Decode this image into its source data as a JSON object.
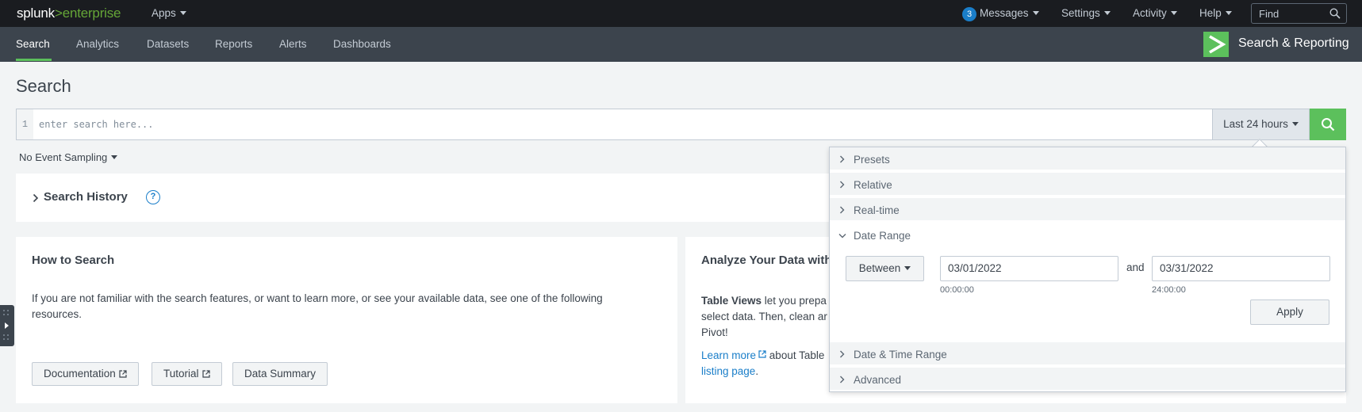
{
  "topbar": {
    "logo_main": "splunk",
    "logo_sep": ">",
    "logo_product": "enterprise",
    "apps_label": "Apps",
    "messages_count": "3",
    "messages_label": "Messages",
    "settings_label": "Settings",
    "activity_label": "Activity",
    "help_label": "Help",
    "find_placeholder": "Find"
  },
  "nav": {
    "tabs": [
      {
        "label": "Search"
      },
      {
        "label": "Analytics"
      },
      {
        "label": "Datasets"
      },
      {
        "label": "Reports"
      },
      {
        "label": "Alerts"
      },
      {
        "label": "Dashboards"
      }
    ],
    "active_tab": "Search",
    "app_title": "Search & Reporting"
  },
  "page": {
    "title": "Search"
  },
  "search": {
    "line_number": "1",
    "placeholder": "enter search here...",
    "time_range": "Last 24 hours",
    "event_sampling": "No Event Sampling"
  },
  "history": {
    "title": "Search History"
  },
  "how_to": {
    "title": "How to Search",
    "text": "If you are not familiar with the search features, or want to learn more, or see your available data, see one of the following resources.",
    "buttons": [
      {
        "label": "Documentation"
      },
      {
        "label": "Tutorial"
      },
      {
        "label": "Data Summary"
      }
    ]
  },
  "analyze": {
    "title": "Analyze Your Data with",
    "line1_bold": "Table Views",
    "line1_rest": " let you prepa",
    "line2": "select data. Then, clean ar",
    "line3": "Pivot!",
    "learn_more": "Learn more",
    "about": " about Table",
    "listing": "listing page",
    "period": "."
  },
  "time_dropdown": {
    "sections": [
      {
        "label": "Presets"
      },
      {
        "label": "Relative"
      },
      {
        "label": "Real-time"
      },
      {
        "label": "Date Range"
      },
      {
        "label": "Date & Time Range"
      },
      {
        "label": "Advanced"
      }
    ],
    "range_mode": "Between",
    "and_label": "and",
    "start_date": "03/01/2022",
    "start_time": "00:00:00",
    "end_date": "03/31/2022",
    "end_time": "24:00:00",
    "apply_label": "Apply"
  },
  "colors": {
    "accent_green": "#5cc05c",
    "link_blue": "#1a7ec9",
    "topbar_bg": "#1a1c20",
    "navbar_bg": "#3c444d"
  }
}
